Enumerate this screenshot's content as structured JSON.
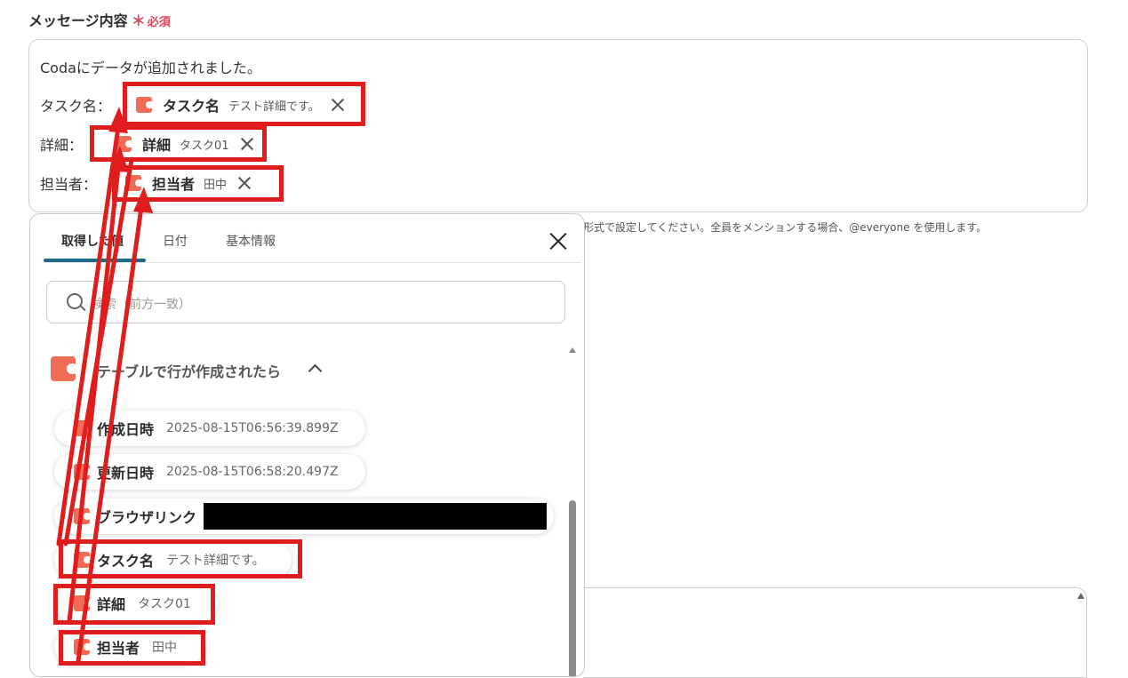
{
  "field": {
    "label": "メッセージ内容",
    "required_mark": "＊",
    "required_text": "必須"
  },
  "message": {
    "line1": "Codaにデータが追加されました。",
    "rows": [
      {
        "label": "タスク名：",
        "chip_name": "タスク名",
        "chip_value": "テスト詳細です。"
      },
      {
        "label": "詳細：",
        "chip_name": "詳細",
        "chip_value": "タスク01"
      },
      {
        "label": "担当者：",
        "chip_name": "担当者",
        "chip_value": "田中"
      }
    ]
  },
  "hint": "形式で設定してください。全員をメンションする場合、@everyone を使用します。",
  "panel": {
    "tabs": [
      "取得した値",
      "日付",
      "基本情報"
    ],
    "active_tab": 0,
    "search_placeholder": "検索（前方一致）",
    "section_title": "テーブルで行が作成されたら",
    "items": [
      {
        "name": "作成日時",
        "value": "2025-08-15T06:56:39.899Z"
      },
      {
        "name": "更新日時",
        "value": "2025-08-15T06:58:20.497Z"
      },
      {
        "name": "ブラウザリンク",
        "value": ""
      },
      {
        "name": "タスク名",
        "value": "テスト詳細です。"
      },
      {
        "name": "詳細",
        "value": "タスク01"
      },
      {
        "name": "担当者",
        "value": "田中"
      }
    ]
  },
  "colors": {
    "accent_red": "#e01d1d",
    "coda": "#f26b54",
    "tab_underline": "#1b6b8a",
    "required": "#e0425a"
  },
  "icons": {
    "chip": "coda-icon",
    "remove": "close-icon",
    "search": "search-icon",
    "collapse": "chevron-up-icon"
  }
}
